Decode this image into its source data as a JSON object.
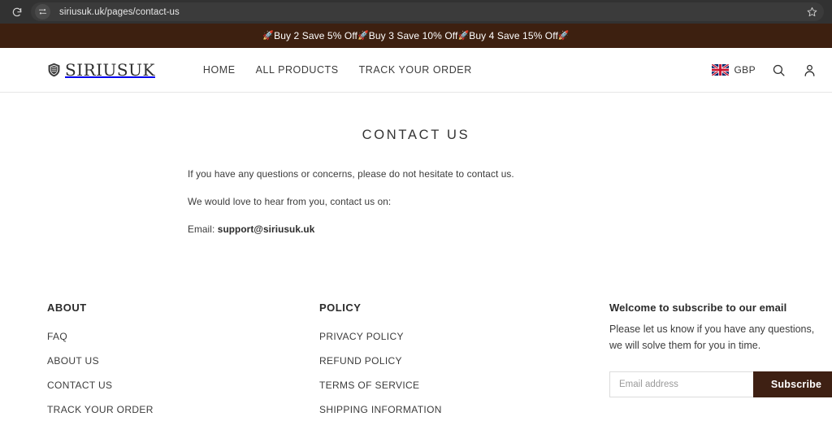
{
  "browser": {
    "url": "siriusuk.uk/pages/contact-us",
    "reload_icon": "reload-icon",
    "site_settings_icon": "site-settings-icon",
    "bookmark_icon": "star-icon"
  },
  "promo_banner": {
    "rocket_icon": "rocket-icon",
    "offers": [
      "Buy 2 Save 5% Off",
      "Buy 3 Save 10% Off",
      "Buy 4 Save 15% Off"
    ],
    "background_color": "#3d2010"
  },
  "header": {
    "logo_text": "SIRIUSUK",
    "logo_mark": "shield-crest-icon",
    "nav": [
      {
        "label": "HOME"
      },
      {
        "label": "ALL PRODUCTS"
      },
      {
        "label": "TRACK YOUR ORDER"
      }
    ],
    "currency": {
      "flag_icon": "uk-flag-icon",
      "code": "GBP"
    },
    "search_icon": "search-icon",
    "account_icon": "account-icon"
  },
  "main": {
    "title": "CONTACT US",
    "paragraph_1": "If you have any questions or concerns, please do not hesitate to contact us.",
    "paragraph_2": "We would love to hear from you, contact us on:",
    "email_label": "Email:",
    "email_value": "support@siriusuk.uk"
  },
  "footer": {
    "about": {
      "heading": "ABOUT",
      "links": [
        {
          "label": "FAQ"
        },
        {
          "label": "ABOUT US"
        },
        {
          "label": "CONTACT US"
        },
        {
          "label": "TRACK YOUR ORDER"
        }
      ]
    },
    "policy": {
      "heading": "POLICY",
      "links": [
        {
          "label": "PRIVACY POLICY"
        },
        {
          "label": "REFUND POLICY"
        },
        {
          "label": "TERMS OF SERVICE"
        },
        {
          "label": "SHIPPING INFORMATION"
        }
      ]
    },
    "newsletter": {
      "title": "Welcome to subscribe to our email",
      "description": "Please let us know if you have any questions, we will solve them for you in time.",
      "email_placeholder": "Email address",
      "email_value": "",
      "subscribe_label": "Subscribe",
      "button_color": "#3e2013"
    }
  }
}
